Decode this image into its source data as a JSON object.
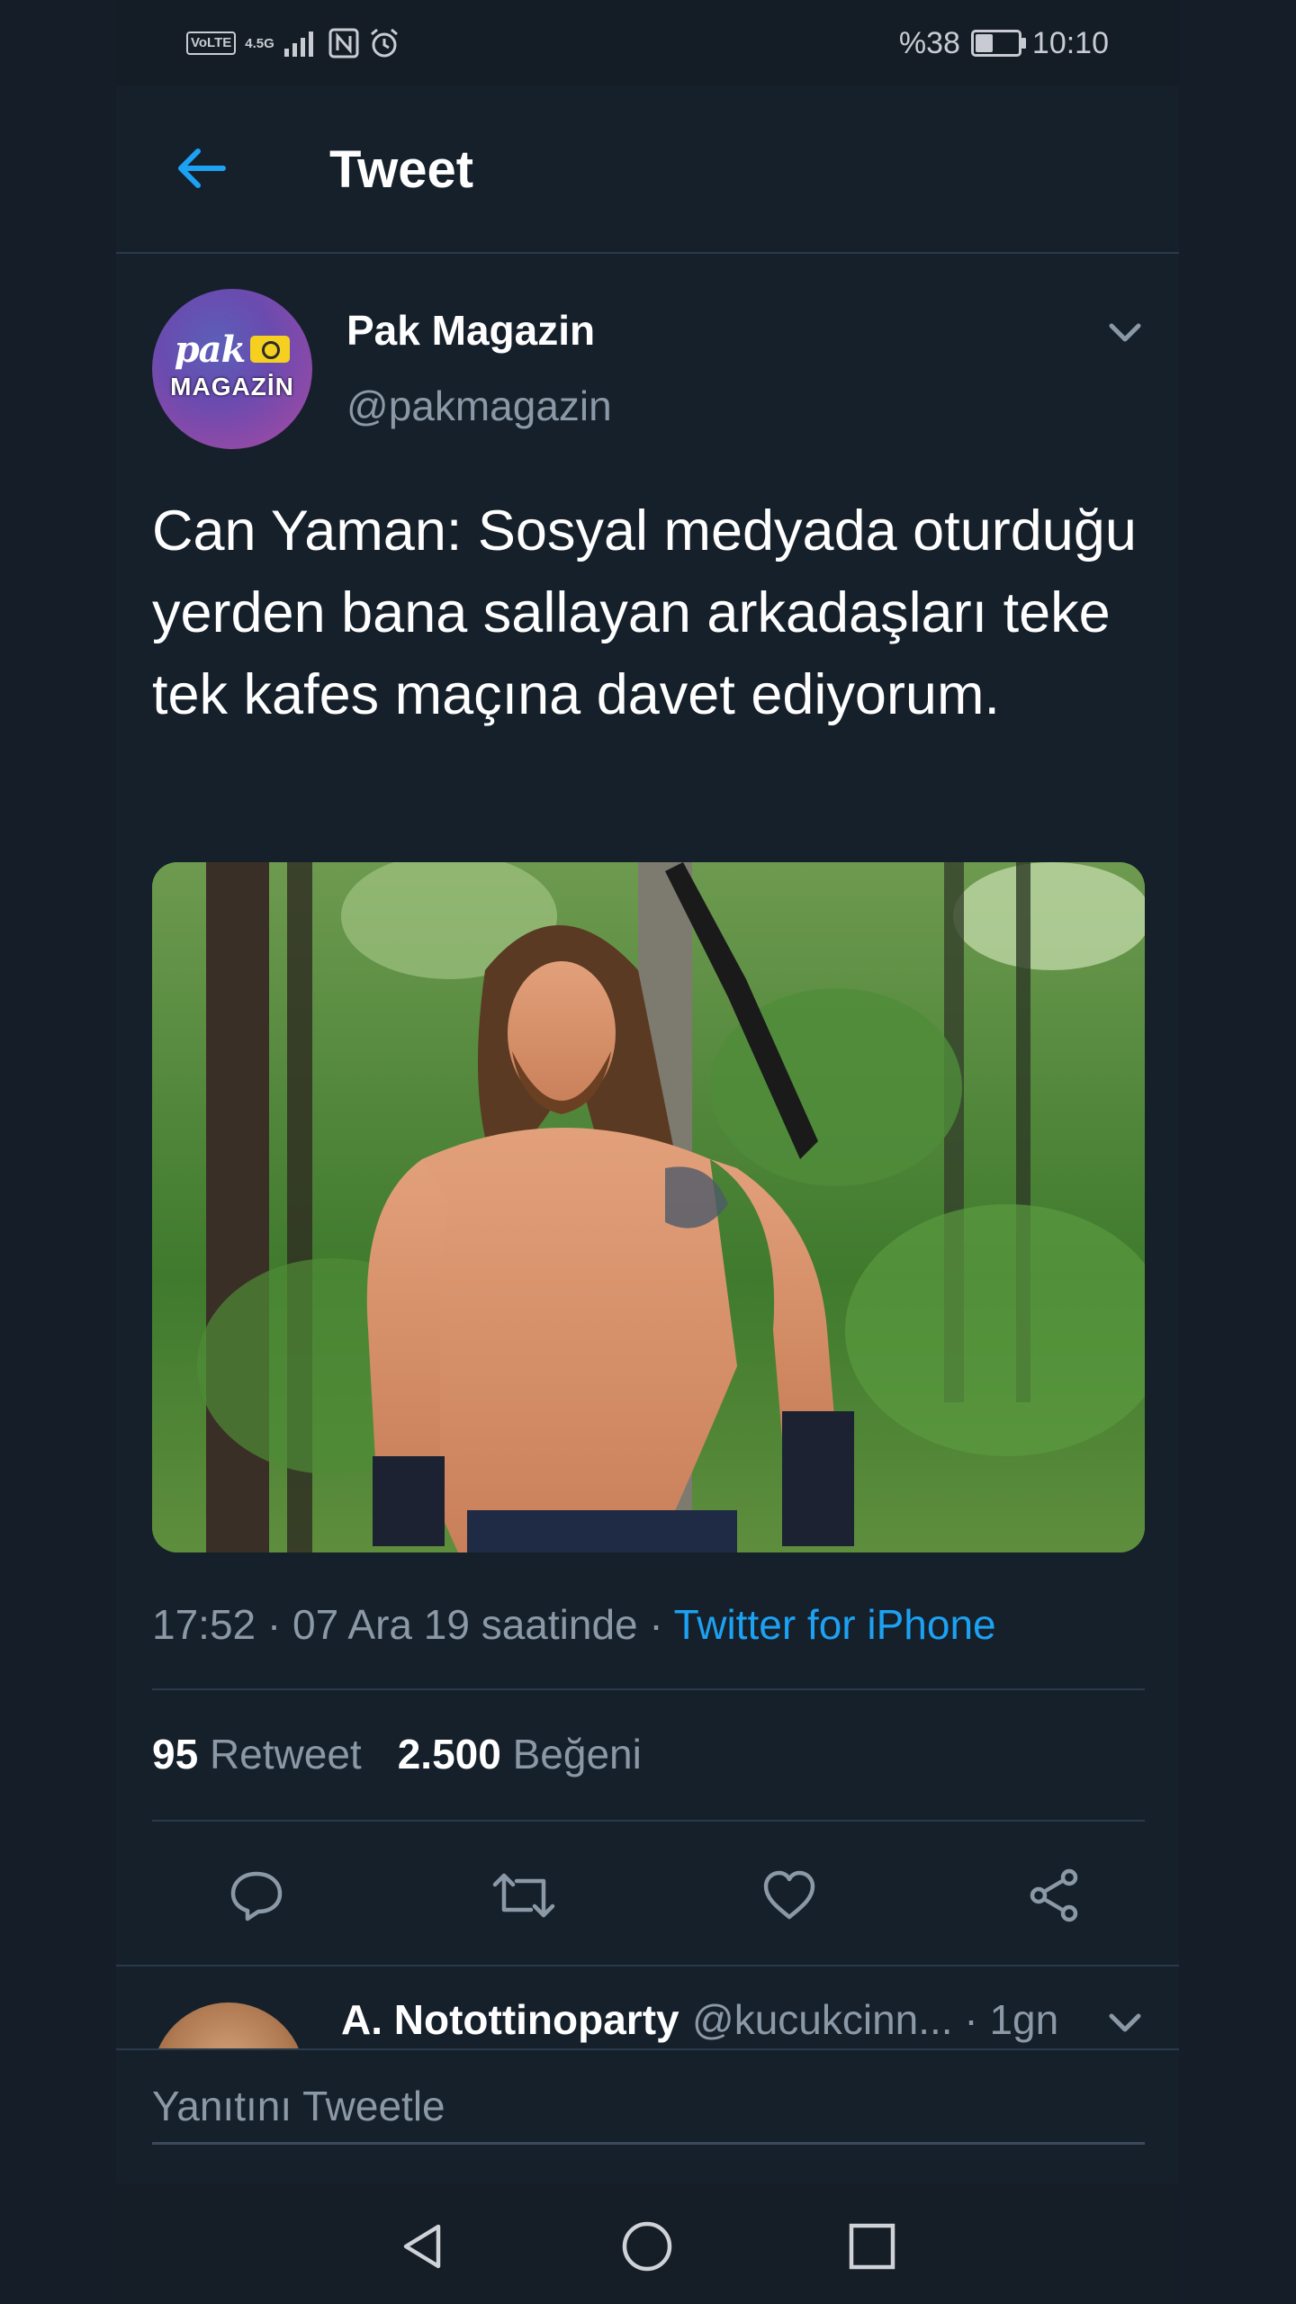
{
  "status_bar": {
    "volte": "VoLTE",
    "network": "4.5G",
    "battery": "%38",
    "battery_level": 0.38,
    "time": "10:10"
  },
  "header": {
    "title": "Tweet"
  },
  "tweet": {
    "avatar_brand_top": "pak",
    "avatar_brand_bottom": "MAGAZİN",
    "display_name": "Pak Magazin",
    "handle": "@pakmagazin",
    "text": "Can Yaman: Sosyal medyada oturduğu yerden bana sallayan arkadaşları teke tek kafes maçına davet ediyorum.",
    "meta_prefix": "17:52 · 07 Ara 19 saatinde · ",
    "source": "Twitter for iPhone",
    "retweet_count": "95",
    "retweet_label": "Retweet",
    "like_count": "2.500",
    "like_label": "Beğeni"
  },
  "reply_preview": {
    "name": "A. Notottinoparty",
    "handle_time": "@kucukcinn... · 1gn"
  },
  "composer": {
    "placeholder": "Yanıtını Tweetle"
  },
  "colors": {
    "background": "#15202b",
    "accent": "#1da1f2",
    "secondary_text": "#8b98a5"
  }
}
